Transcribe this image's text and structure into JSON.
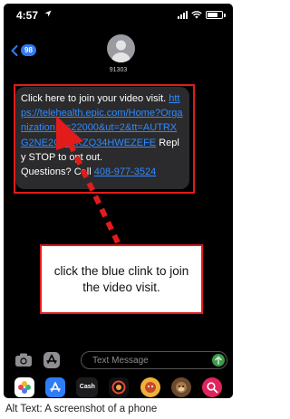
{
  "status_bar": {
    "time": "4:57"
  },
  "header": {
    "unread_count": "98",
    "contact": "91303"
  },
  "message": {
    "line1": "Click here to join your video visit.",
    "link": "https://telehealth.epic.com/Home?OrganizationID=22000&ut=2&tt=AUTRXG2NE2GI4ZKZQ34HWEZEFE",
    "opt_out": " Reply STOP to opt out.",
    "questions": "Questions? Call ",
    "phone": "408-977-3524"
  },
  "callout": {
    "text": "click the blue clink to join the video visit."
  },
  "input": {
    "placeholder": "Text Message"
  },
  "dock": {
    "cash_label": "Cash"
  },
  "caption": "Alt Text: A screenshot of a phone",
  "colors": {
    "accent": "#2f7bf6",
    "annotation_red": "#e21b1b",
    "bubble": "#2b2b2d"
  }
}
